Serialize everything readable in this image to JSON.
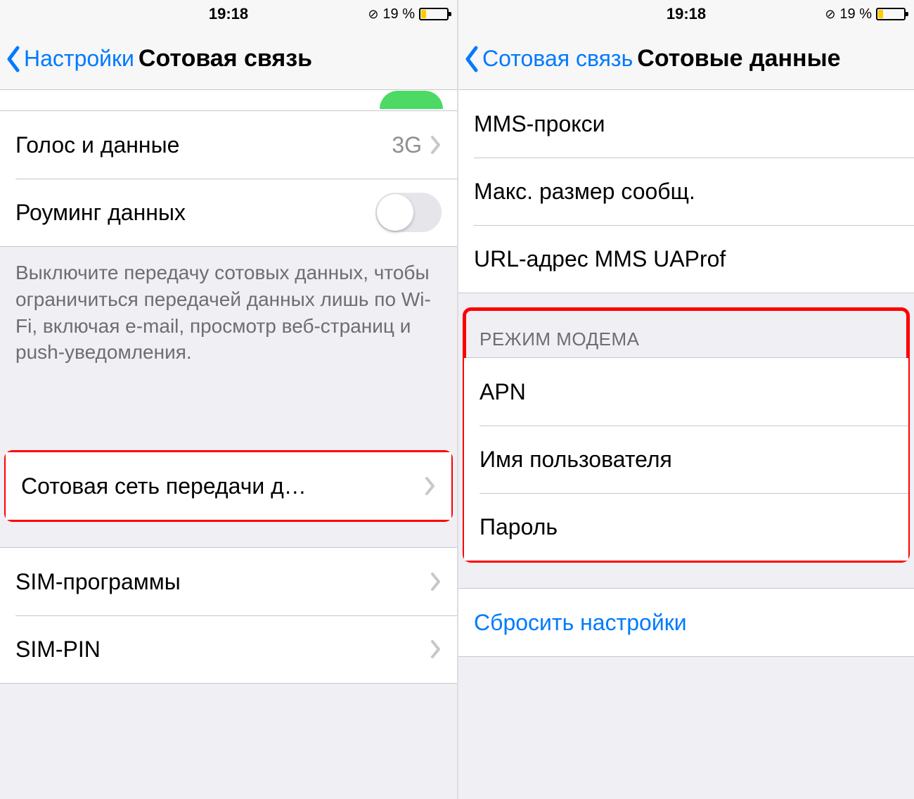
{
  "status": {
    "time": "19:18",
    "battery_percent": "19 %"
  },
  "screen1": {
    "back_label": "Настройки",
    "title": "Сотовая связь",
    "rows": {
      "voice_data": {
        "label": "Голос и данные",
        "value": "3G"
      },
      "roaming": {
        "label": "Роуминг данных"
      }
    },
    "footer": "Выключите передачу сотовых данных, чтобы ограничиться передачей данных лишь по Wi-Fi, включая e-mail, просмотр веб-страниц и push-уведомления.",
    "cellular_network": "Сотовая сеть передачи д…",
    "sim_apps": "SIM-программы",
    "sim_pin": "SIM-PIN"
  },
  "screen2": {
    "back_label": "Сотовая связь",
    "title": "Сотовые данные",
    "mms_proxy": "MMS-прокси",
    "max_msg_size": "Макс. размер сообщ.",
    "uaprof": "URL-адрес MMS UAProf",
    "modem_header": "РЕЖИМ МОДЕМА",
    "apn": "APN",
    "username": "Имя пользователя",
    "password": "Пароль",
    "reset": "Сбросить настройки"
  }
}
